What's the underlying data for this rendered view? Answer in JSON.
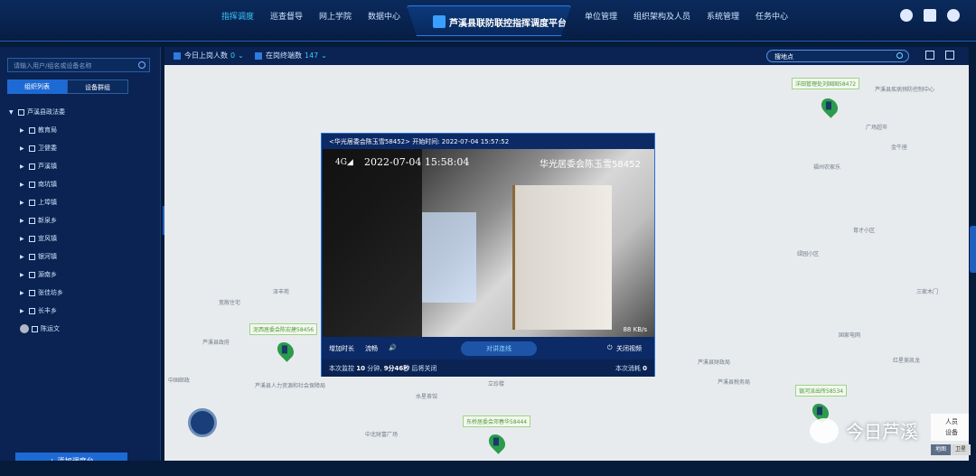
{
  "header": {
    "nav_left": [
      "指挥调度",
      "巡查督导",
      "网上学院",
      "数据中心"
    ],
    "nav_right": [
      "单位管理",
      "组织架构及人员",
      "系统管理",
      "任务中心"
    ],
    "app_title": "芦溪县联防联控指挥调度平台"
  },
  "sidebar": {
    "search_placeholder": "请输入用户/组名或设备名称",
    "tab_org": "组织列表",
    "tab_devices": "设备群组",
    "root": "芦溪县政法委",
    "items": [
      "教育局",
      "卫健委",
      "芦溪镇",
      "南坑镇",
      "上埠镇",
      "新泉乡",
      "宣风镇",
      "银河镇",
      "源南乡",
      "张佳坊乡",
      "长丰乡"
    ],
    "user": "陈运文",
    "add_button": "+ 添加调度台"
  },
  "toolbar": {
    "online_label": "今日上岗人数",
    "online_count": "0",
    "terminal_label": "在岗终端数",
    "terminal_count": "147",
    "map_search_placeholder": "搜地点"
  },
  "map": {
    "labels": [
      "泽丰苑",
      "芦溪县政府",
      "宽敞住宅",
      "中国邮政",
      "芦溪县人力资源和社会保障局",
      "水星茶馆",
      "立珍楼",
      "中北财富广场",
      "芦溪县疾病预防控制中心",
      "广场超市",
      "金牛座",
      "福州农家乐",
      "育才小区",
      "绿园小区",
      "三家木门",
      "国家电网",
      "红星美凯龙",
      "芦溪县财政局",
      "芦溪县税务局"
    ],
    "markers": [
      "洋田管理处刘国国58472",
      "泥西居委会陈宏建58456",
      "东桥居委会邓春华58444",
      "银河派出所58534"
    ]
  },
  "video_dialog": {
    "title": "<华光居委会陈玉雪58452> 开始时间: 2022-07-04 15:57:52",
    "overlay_time": "2022-07-04 15:58:04",
    "overlay_signal": "4G◢",
    "overlay_name": "华光居委会陈玉雪58452",
    "bitrate": "88 KB/s",
    "ctrl_extend": "增加时长",
    "ctrl_quality": "流畅",
    "ctrl_talk": "对讲连线",
    "ctrl_close": "关闭视频",
    "status_prefix": "本次监控",
    "status_minutes": "10",
    "status_mid": "分钟,",
    "status_remaining": "9分46秒",
    "status_suffix": "后将关闭",
    "status_right_label": "本次消耗",
    "status_right_value": "0"
  },
  "legend": {
    "people": "人员",
    "devices": "设备"
  },
  "map_type": [
    "地图",
    "卫星"
  ],
  "watermark": "今日芦溪"
}
